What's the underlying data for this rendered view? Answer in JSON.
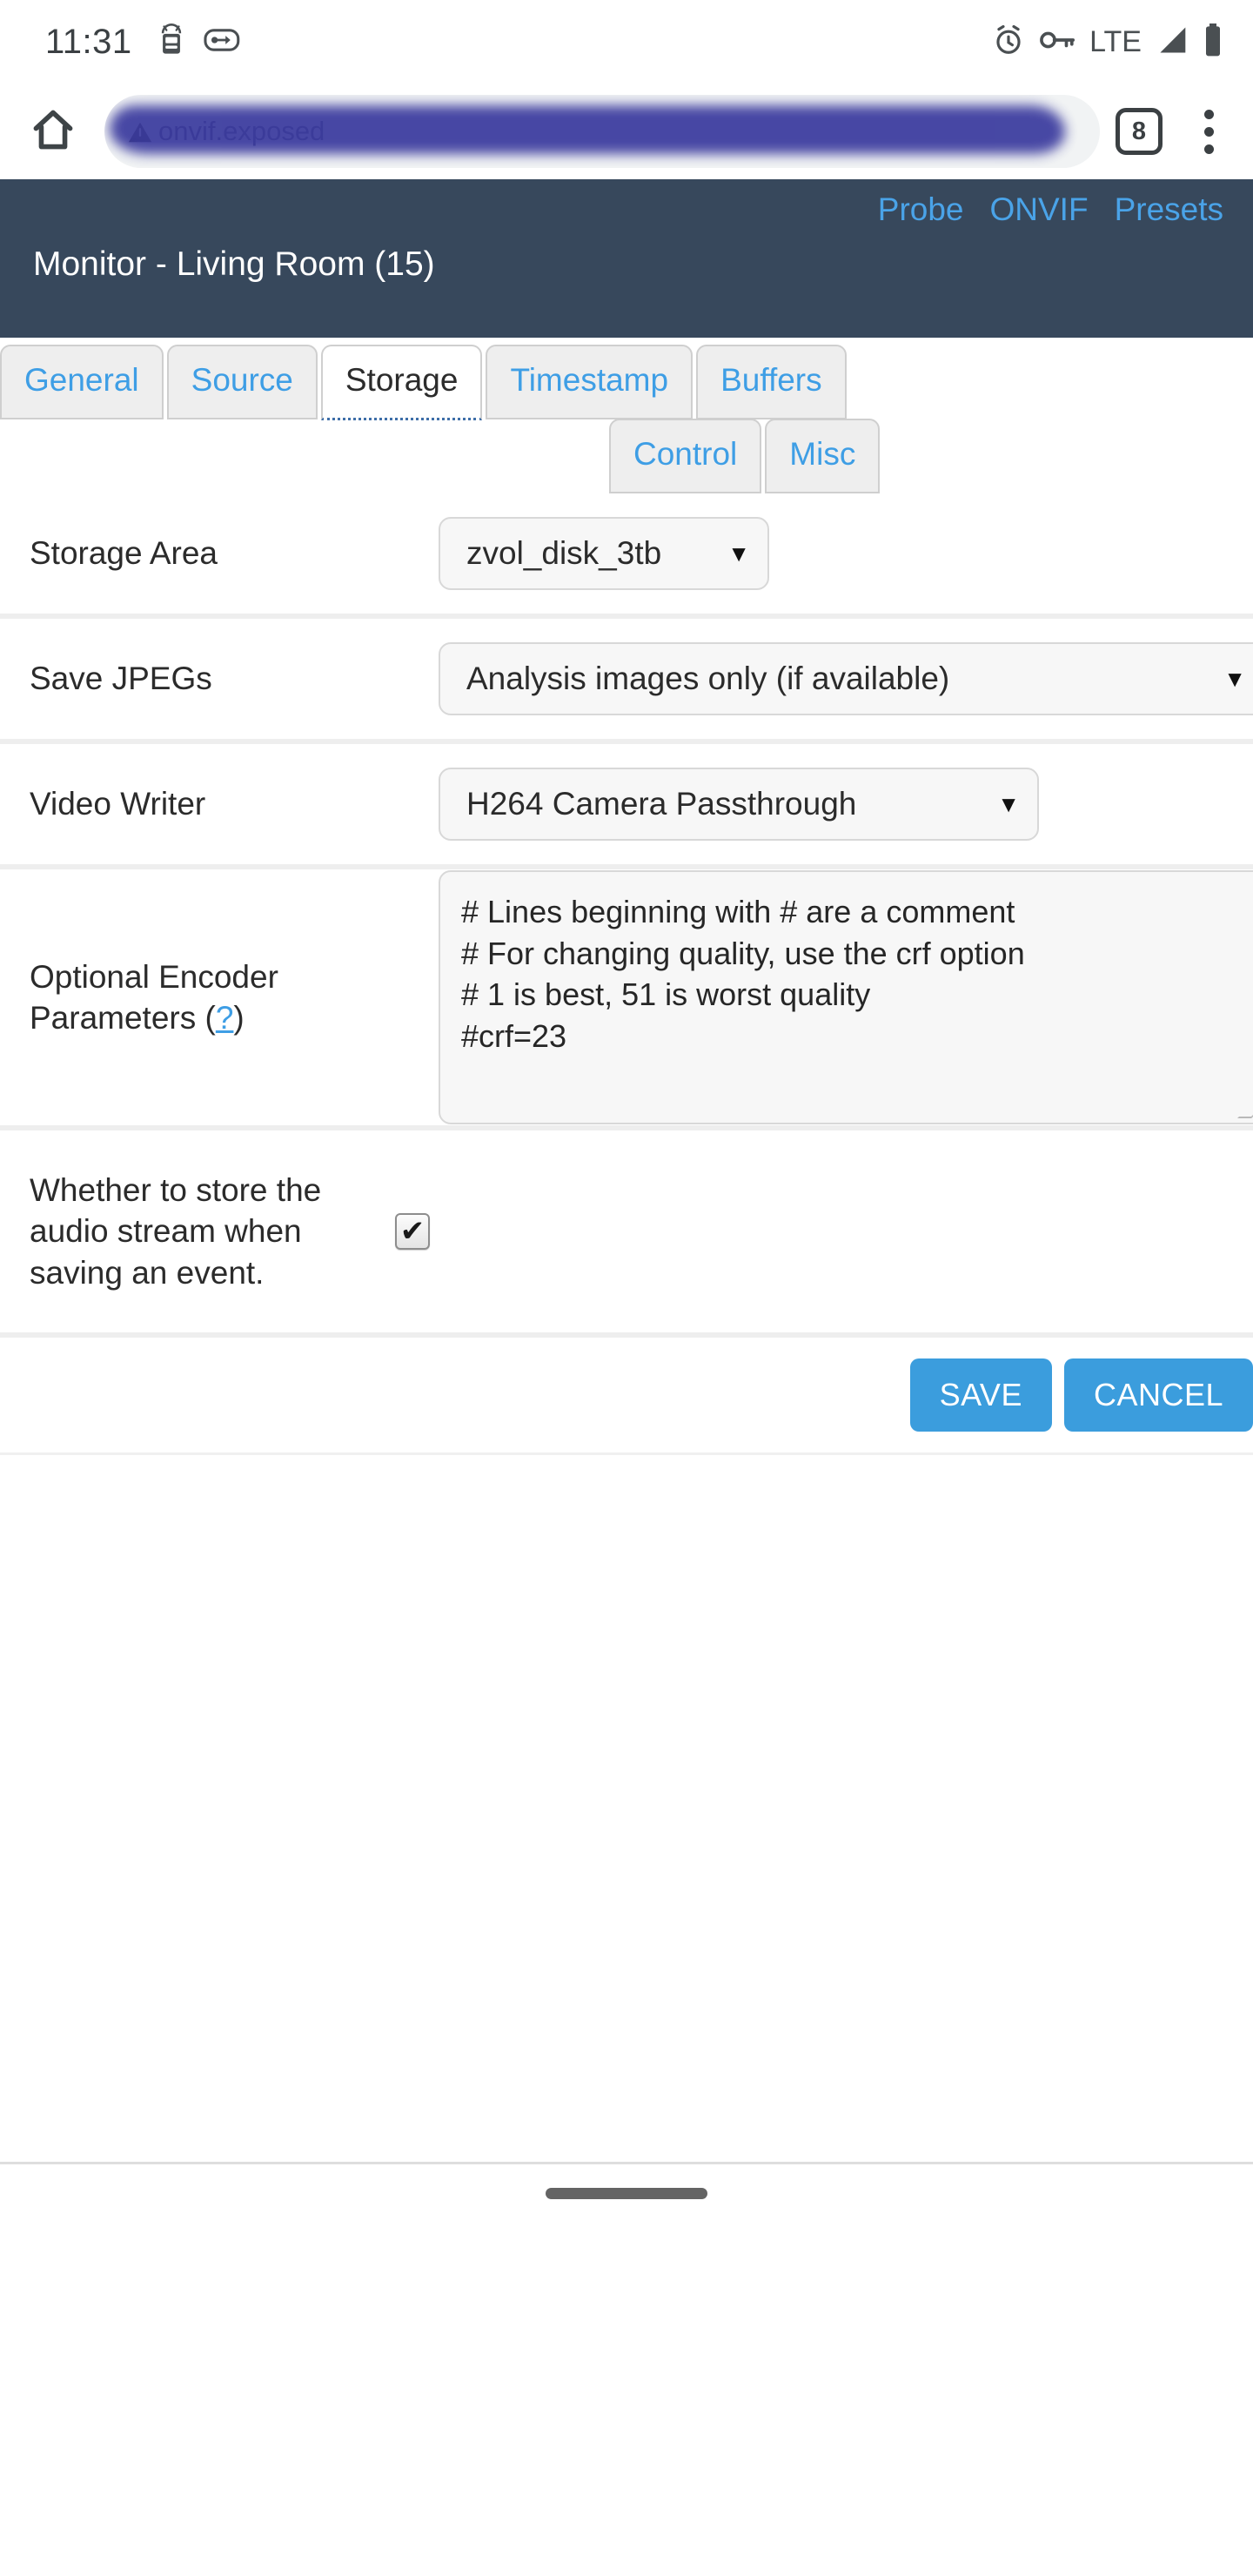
{
  "status_bar": {
    "clock": "11:31",
    "left_icons": [
      "android-keyboard-icon",
      "usb-debug-icon"
    ],
    "right_icons": [
      "alarm-icon",
      "vpn-key-icon",
      "signal-icon",
      "battery-icon"
    ],
    "network_label": "LTE"
  },
  "browser": {
    "home_icon": "home-icon",
    "url_text": "onvif.exposed",
    "url_redacted": true,
    "tab_count": "8",
    "menu_icon": "kebab-menu-icon"
  },
  "zm_header": {
    "title": "Monitor - Living Room (15)",
    "links": [
      {
        "label": "Probe",
        "name": "probe-link"
      },
      {
        "label": "ONVIF",
        "name": "onvif-link"
      },
      {
        "label": "Presets",
        "name": "presets-link"
      }
    ],
    "bg_color": "#37485c",
    "link_color": "#4aa3e8"
  },
  "tabs": {
    "row1": [
      {
        "label": "General",
        "active": false
      },
      {
        "label": "Source",
        "active": false
      },
      {
        "label": "Storage",
        "active": true
      },
      {
        "label": "Timestamp",
        "active": false
      },
      {
        "label": "Buffers",
        "active": false
      }
    ],
    "row2": [
      {
        "label": "Control",
        "active": false
      },
      {
        "label": "Misc",
        "active": false
      }
    ],
    "active_tab": "Storage"
  },
  "form": {
    "storage_area": {
      "label": "Storage Area",
      "value": "zvol_disk_3tb",
      "caret": "▼"
    },
    "save_jpegs": {
      "label": "Save JPEGs",
      "value": "Analysis images only (if available)",
      "caret": "▼"
    },
    "video_writer": {
      "label": "Video Writer",
      "value": "H264 Camera Passthrough",
      "caret": "▼"
    },
    "encoder_params": {
      "label_main": "Optional Encoder Parameters (",
      "label_help": "?",
      "label_close": ")",
      "value": "# Lines beginning with # are a comment\n# For changing quality, use the crf option\n# 1 is best, 51 is worst quality\n#crf=23"
    },
    "store_audio": {
      "label": "Whether to store the audio stream when saving an event.",
      "checked": true,
      "check_glyph": "✔"
    }
  },
  "actions": {
    "save_label": "SAVE",
    "cancel_label": "CANCEL",
    "button_color": "#3b9ddd"
  }
}
